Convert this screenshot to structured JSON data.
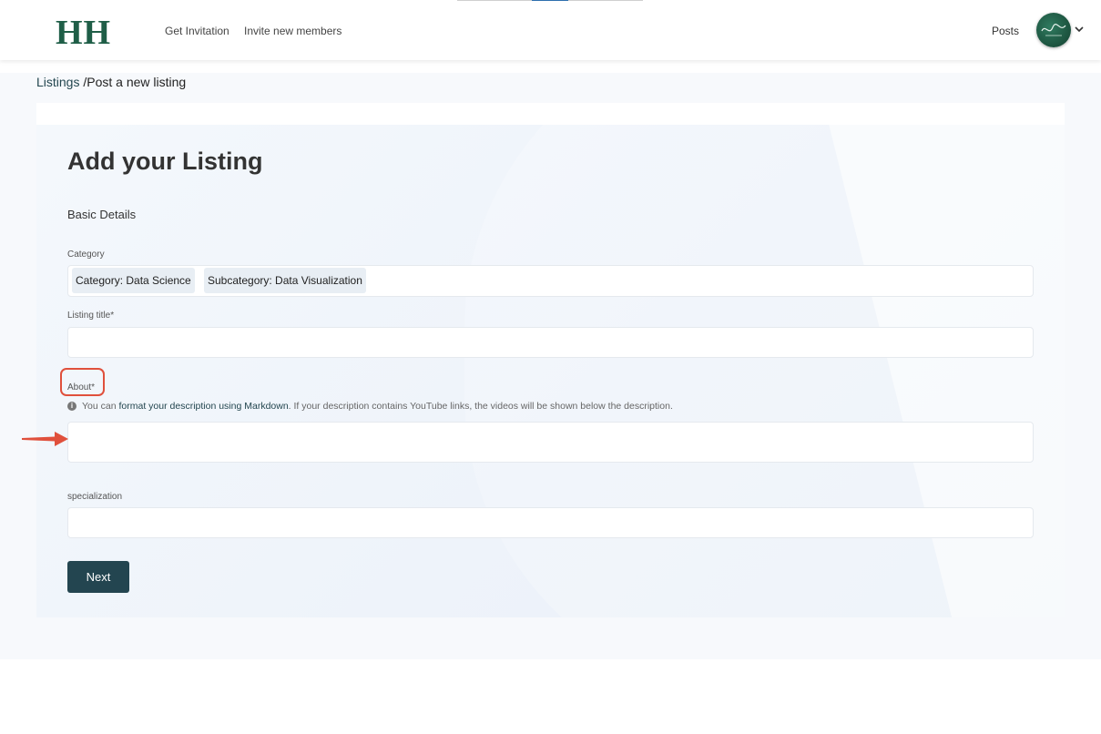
{
  "header": {
    "logo": "HH",
    "nav": [
      "Get Invitation",
      "Invite new members"
    ],
    "posts": "Posts"
  },
  "breadcrumb": {
    "root": "Listings",
    "separator": " /",
    "current": "Post a new listing"
  },
  "form": {
    "title": "Add your Listing",
    "section": "Basic Details",
    "category_label": "Category",
    "category_chips": [
      "Category: Data Science",
      "Subcategory: Data Visualization"
    ],
    "listing_title_label": "Listing title*",
    "listing_title_value": "",
    "about_label": "About*",
    "about_hint_prefix": "You can ",
    "about_hint_link": "format your description using Markdown",
    "about_hint_suffix": ". If your description contains YouTube links, the videos will be shown below the description.",
    "about_value": "",
    "specialization_label": "specialization",
    "specialization_value": "",
    "next_label": "Next"
  },
  "colors": {
    "brand": "#1f5e47",
    "primary_button": "#234550",
    "annotation": "#e0503c"
  },
  "icons": {
    "info": "info-icon",
    "chevron": "chevron-down-icon",
    "arrow": "arrow-right-icon"
  }
}
